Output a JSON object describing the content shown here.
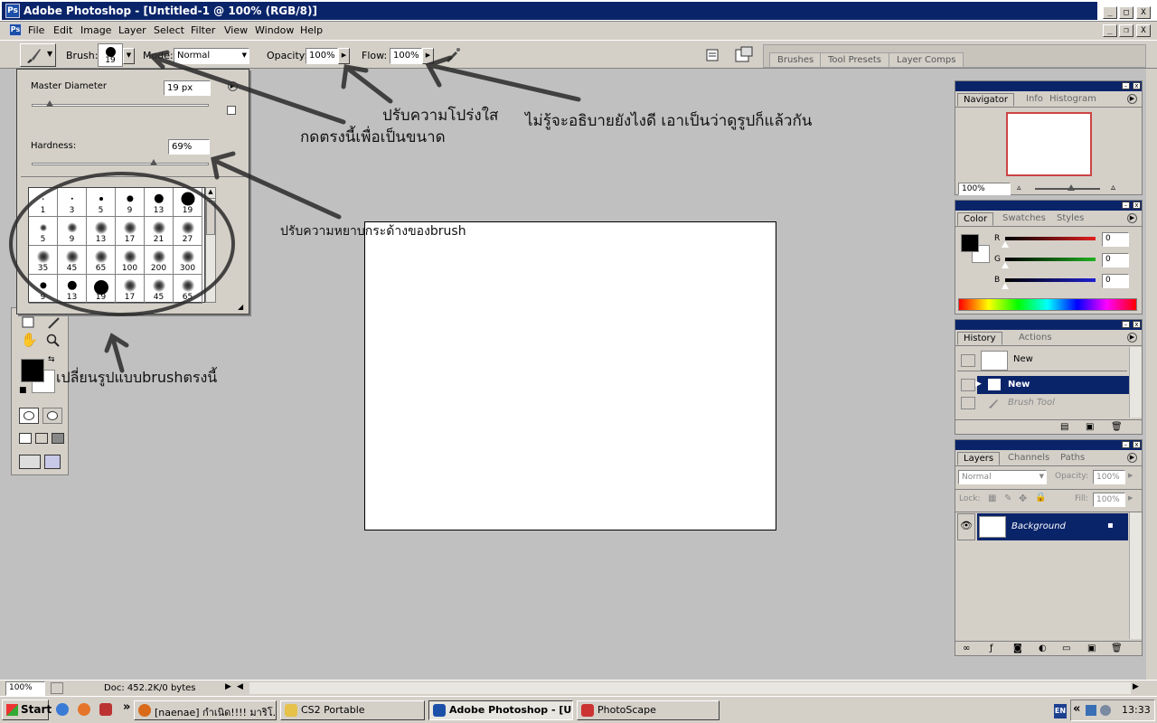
{
  "window": {
    "title": "Adobe Photoshop - [Untitled-1 @ 100% (RGB/8)]",
    "controls": {
      "minimize": "_",
      "maximize": "□",
      "close": "X"
    },
    "doc_controls": {
      "minimize": "_",
      "restore": "❐",
      "close": "X"
    }
  },
  "menubar": [
    "File",
    "Edit",
    "Image",
    "Layer",
    "Select",
    "Filter",
    "View",
    "Window",
    "Help"
  ],
  "options_bar": {
    "brush_label": "Brush:",
    "brush_size": "19",
    "mode_label": "Mode:",
    "mode_value": "Normal",
    "opacity_label": "Opacity:",
    "opacity_value": "100%",
    "flow_label": "Flow:",
    "flow_value": "100%",
    "well_tabs": [
      "Brushes",
      "Tool Presets",
      "Layer Comps"
    ]
  },
  "brush_popup": {
    "master_diameter_label": "Master Diameter",
    "master_diameter_value": "19 px",
    "master_diameter_fraction": 0.1,
    "hardness_label": "Hardness:",
    "hardness_value": "69%",
    "hardness_fraction": 0.69,
    "presets": [
      {
        "size": "1",
        "hard": true
      },
      {
        "size": "3",
        "hard": true
      },
      {
        "size": "5",
        "hard": true
      },
      {
        "size": "9",
        "hard": true
      },
      {
        "size": "13",
        "hard": true
      },
      {
        "size": "19",
        "hard": true
      },
      {
        "size": "5",
        "hard": false
      },
      {
        "size": "9",
        "hard": false
      },
      {
        "size": "13",
        "hard": false
      },
      {
        "size": "17",
        "hard": false
      },
      {
        "size": "21",
        "hard": false
      },
      {
        "size": "27",
        "hard": false
      },
      {
        "size": "35",
        "hard": false
      },
      {
        "size": "45",
        "hard": false
      },
      {
        "size": "65",
        "hard": false
      },
      {
        "size": "100",
        "hard": false
      },
      {
        "size": "200",
        "hard": false
      },
      {
        "size": "300",
        "hard": false
      },
      {
        "size": "9",
        "hard": true
      },
      {
        "size": "13",
        "hard": true
      },
      {
        "size": "19",
        "hard": true
      },
      {
        "size": "17",
        "hard": false
      },
      {
        "size": "45",
        "hard": false
      },
      {
        "size": "65",
        "hard": false
      }
    ]
  },
  "annotations": {
    "click_here_for_size": "กดตรงนี้เพื่อเป็นขนาด",
    "adjust_opacity": "ปรับความโปร่งใส",
    "dont_know_explain": "ไม่รู้จะอธิบายยังไงดี เอาเป็นว่าดูรูปก็แล้วกัน",
    "adjust_hardness": "ปรับความหยาบกระด้างของbrush",
    "change_brush_shape": "เปลี่ยนรูปแบบbrushตรงนี้"
  },
  "navigator": {
    "tabs": [
      "Navigator",
      "Info",
      "Histogram"
    ],
    "zoom": "100%",
    "zoom_fraction": 0.55
  },
  "color": {
    "tabs": [
      "Color",
      "Swatches",
      "Styles"
    ],
    "channels": [
      {
        "label": "R",
        "value": "0",
        "color": "#e02020"
      },
      {
        "label": "G",
        "value": "0",
        "color": "#20b020"
      },
      {
        "label": "B",
        "value": "0",
        "color": "#2020d0"
      }
    ]
  },
  "history": {
    "tabs": [
      "History",
      "Actions"
    ],
    "snapshot": "New",
    "states": [
      {
        "label": "New",
        "active": true
      },
      {
        "label": "Brush Tool",
        "active": false
      }
    ]
  },
  "layers": {
    "tabs": [
      "Layers",
      "Channels",
      "Paths"
    ],
    "blend_mode": "Normal",
    "opacity_label": "Opacity:",
    "opacity_value": "100%",
    "lock_label": "Lock:",
    "fill_label": "Fill:",
    "fill_value": "100%",
    "layer_name": "Background"
  },
  "status_bar": {
    "zoom": "100%",
    "doc_info": "Doc: 452.2K/0 bytes"
  },
  "taskbar": {
    "start": "Start",
    "quicklaunch_more": "»",
    "tasks": [
      {
        "label": "[naenae] กำเนิด!!!! มาริโ...",
        "active": false,
        "icon_color": "#d86a1a"
      },
      {
        "label": "CS2 Portable",
        "active": false,
        "icon_color": "#e6c24a"
      },
      {
        "label": "Adobe Photoshop - [U...",
        "active": true,
        "icon_color": "#1c4fa8"
      },
      {
        "label": "PhotoScape",
        "active": false,
        "icon_color": "#cc3333"
      }
    ],
    "language": "EN",
    "tray_more": "«",
    "time": "13:33"
  }
}
